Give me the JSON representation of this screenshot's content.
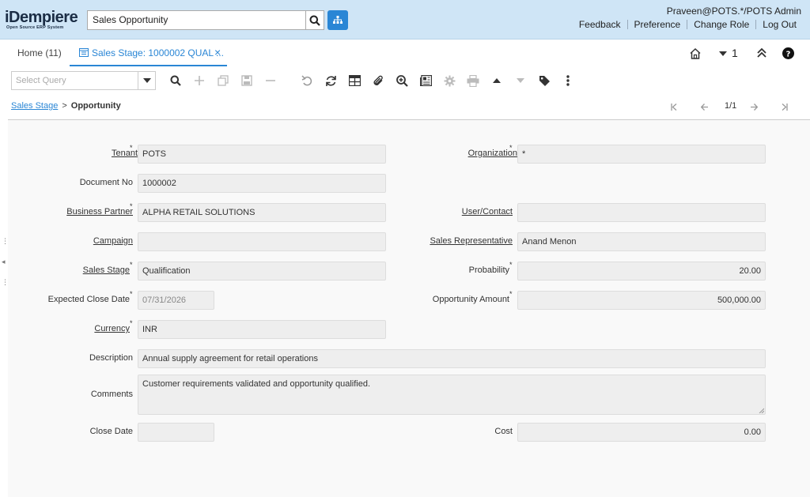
{
  "header": {
    "logo_main": "iDempiere",
    "logo_sub": "Open Source ERP System",
    "search_value": "Sales Opportunity",
    "user": "Praveen@POTS.*/POTS Admin",
    "links": [
      "Feedback",
      "Preference",
      "Change Role",
      "Log Out"
    ]
  },
  "tabs": {
    "home_label": "Home (11)",
    "active_label": "Sales Stage: 1000002 QUAL ...",
    "close_glyph": "×",
    "counter": "1"
  },
  "toolbar": {
    "select_query_placeholder": "Select Query"
  },
  "breadcrumb": {
    "parent": "Sales Stage",
    "separator": ">",
    "current": "Opportunity",
    "record_count": "1/1"
  },
  "form": {
    "tenant_label": "Tenant",
    "tenant_value": "POTS",
    "organization_label": "Organization",
    "organization_value": "*",
    "document_no_label": "Document No",
    "document_no_value": "1000002",
    "business_partner_label": "Business Partner",
    "business_partner_value": "ALPHA RETAIL SOLUTIONS",
    "user_contact_label": "User/Contact",
    "user_contact_value": "",
    "campaign_label": "Campaign",
    "campaign_value": "",
    "sales_rep_label": "Sales Representative",
    "sales_rep_value": "Anand Menon",
    "sales_stage_label": "Sales Stage",
    "sales_stage_value": "Qualification",
    "probability_label": "Probability",
    "probability_value": "20.00",
    "expected_close_label": "Expected Close Date",
    "expected_close_value": "07/31/2026",
    "opportunity_amount_label": "Opportunity Amount",
    "opportunity_amount_value": "500,000.00",
    "currency_label": "Currency",
    "currency_value": "INR",
    "description_label": "Description",
    "description_value": "Annual supply agreement for retail operations",
    "comments_label": "Comments",
    "comments_value": "Customer requirements validated and opportunity qualified.",
    "close_date_label": "Close Date",
    "close_date_value": "",
    "cost_label": "Cost",
    "cost_value": "0.00",
    "required_marker": "*"
  },
  "colors": {
    "header_bg": "#cfe5f6",
    "accent": "#2a86d5",
    "field_bg": "#eeeeee"
  }
}
